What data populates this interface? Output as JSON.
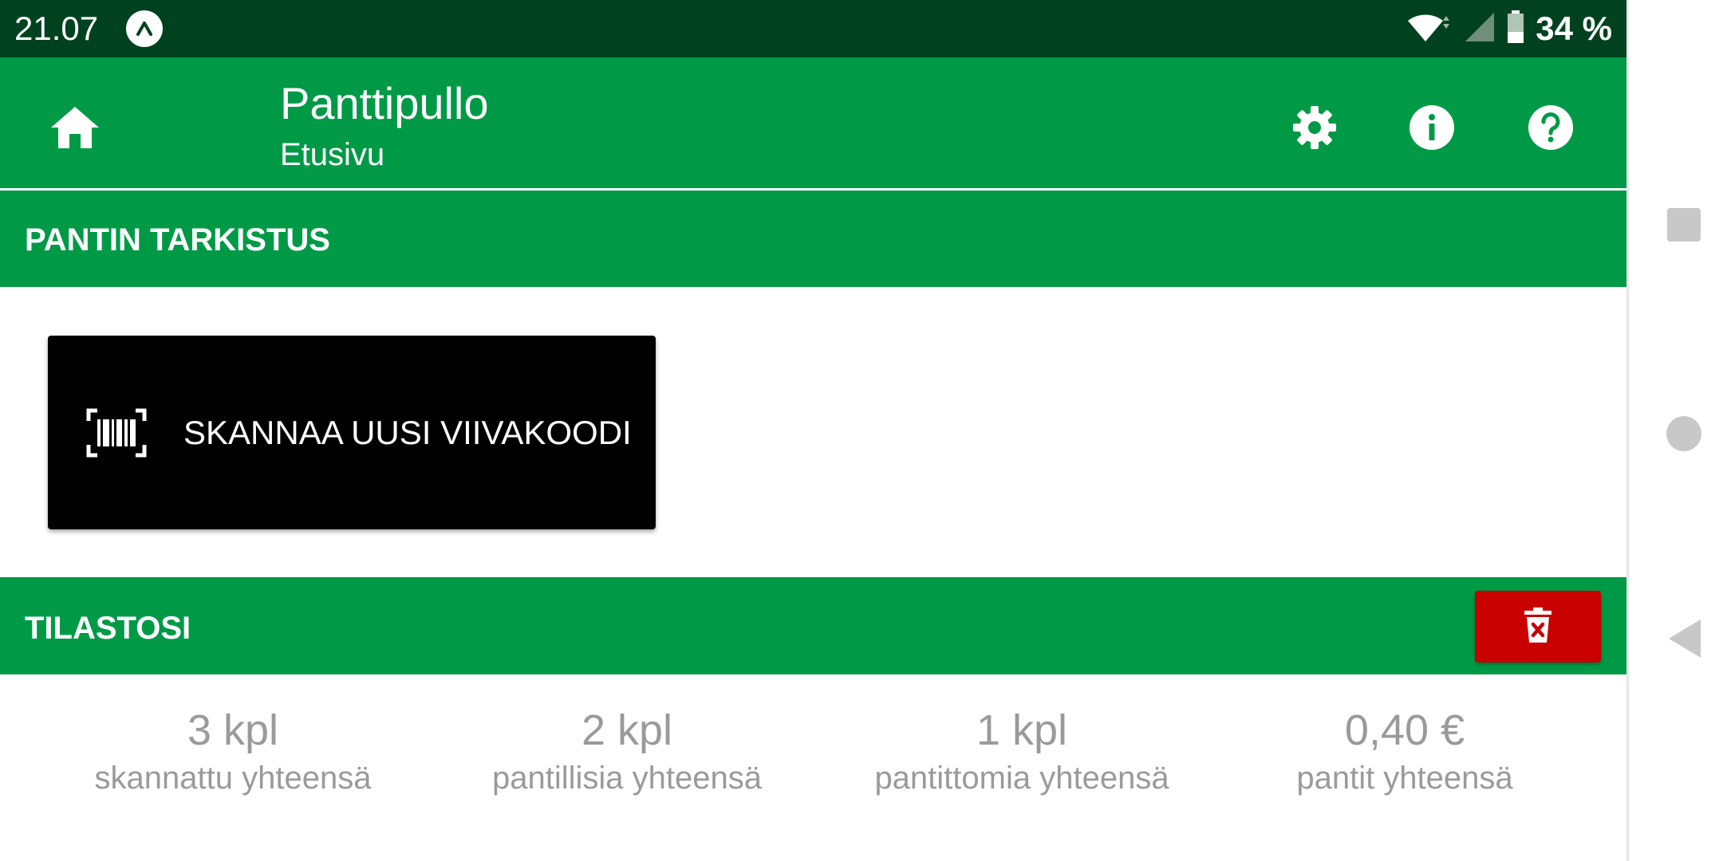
{
  "status_bar": {
    "time": "21.07",
    "battery": "34 %",
    "icons": [
      "app-notification-icon",
      "wifi-icon",
      "signal-icon",
      "battery-icon"
    ]
  },
  "toolbar": {
    "title": "Panttipullo",
    "subtitle": "Etusivu",
    "icons": [
      "home-icon",
      "settings-icon",
      "info-icon",
      "help-icon"
    ]
  },
  "sections": {
    "check": {
      "title": "PANTIN TARKISTUS",
      "scan_button_label": "SKANNAA UUSI VIIVAKOODI"
    },
    "stats": {
      "title": "TILASTOSI",
      "items": [
        {
          "value": "3 kpl",
          "label": "skannattu yhteensä"
        },
        {
          "value": "2 kpl",
          "label": "pantillisia yhteensä"
        },
        {
          "value": "1 kpl",
          "label": "pantittomia yhteensä"
        },
        {
          "value": "0,40 €",
          "label": "pantit yhteensä"
        }
      ]
    }
  },
  "colors": {
    "status_bar": "#00421f",
    "primary": "#009a47",
    "scan_button": "#000000",
    "delete_button": "#c80000",
    "stat_text": "#9a9a9a"
  },
  "system_nav": [
    "recents-button",
    "home-button",
    "back-button"
  ]
}
